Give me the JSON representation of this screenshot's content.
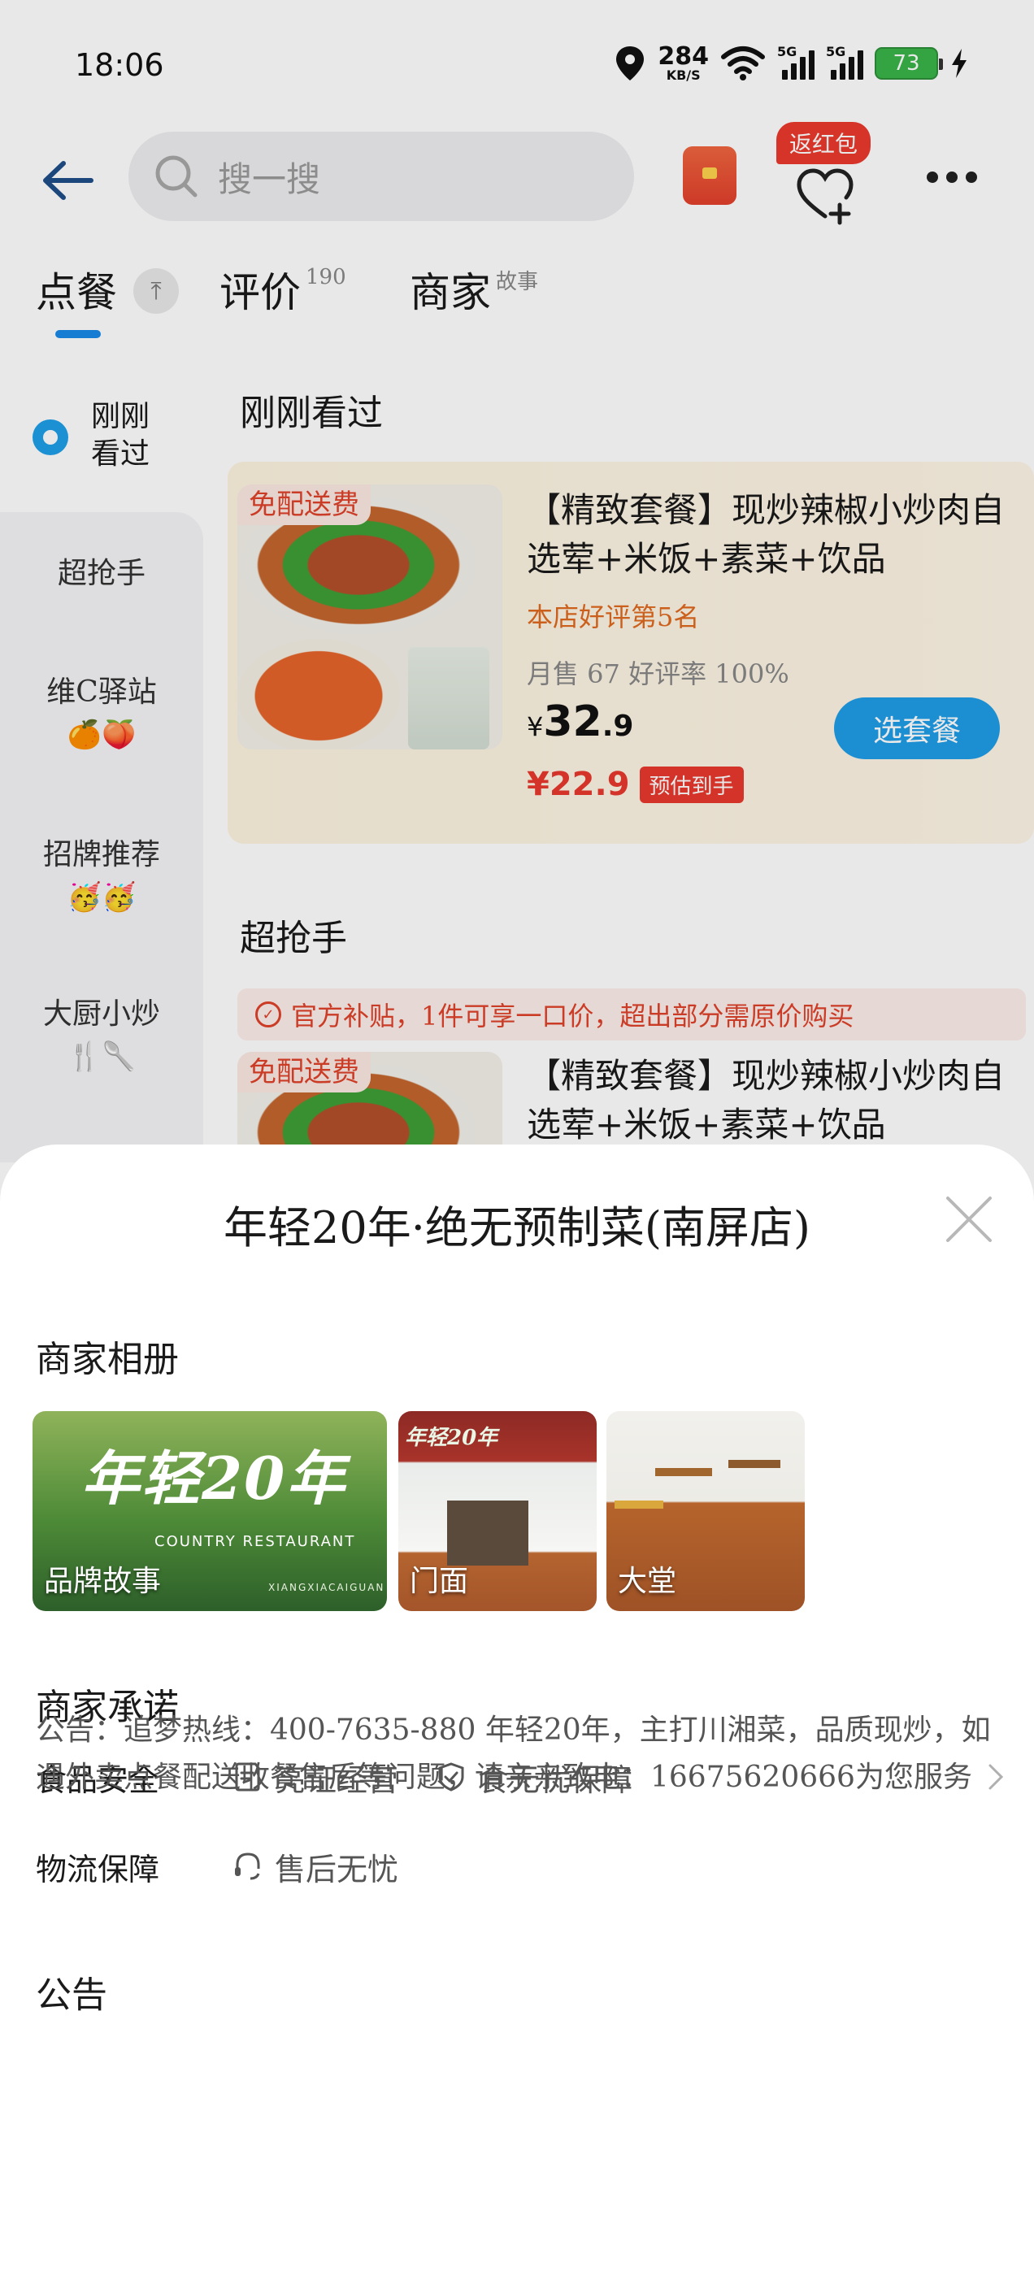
{
  "status_bar": {
    "time": "18:06",
    "net_speed": "284",
    "net_unit": "KB/S",
    "signal1_label": "5G",
    "signal2_label": "5G",
    "battery": "73"
  },
  "header": {
    "search_placeholder": "搜一搜",
    "fav_badge": "返红包"
  },
  "tabs": [
    {
      "label": "点餐",
      "sup": ""
    },
    {
      "label": "评价",
      "sup": "190"
    },
    {
      "label": "商家",
      "sup": "故事"
    }
  ],
  "sidebar": {
    "recent": "刚刚看过",
    "items": [
      {
        "label": "超抢手",
        "emoji": ""
      },
      {
        "label": "维C驿站",
        "emoji": "🍊🍑"
      },
      {
        "label": "招牌推荐",
        "emoji": "🥳🥳"
      },
      {
        "label": "大厨小炒",
        "emoji": "🍴🥄"
      }
    ]
  },
  "main": {
    "recent_title": "刚刚看过",
    "hot_title": "超抢手",
    "subsidy_text": "官方补贴，1件可享一口价，超出部分需原价购买",
    "cards": [
      {
        "free_tag": "免配送费",
        "title": "【精致套餐】现炒辣椒小炒肉自选荤+米饭+素菜+饮品",
        "rank": "本店好评第5名",
        "sales": "月售 67 好评率 100%",
        "price_currency": "¥",
        "price_int": "32",
        "price_dec": ".9",
        "est_price": "¥22.9",
        "est_tag": "预估到手",
        "button": "选套餐"
      },
      {
        "free_tag": "免配送费",
        "title": "【精致套餐】现炒辣椒小炒肉自选荤+米饭+素菜+饮品"
      }
    ]
  },
  "sheet": {
    "title": "年轻20年·绝无预制菜(南屏店)",
    "album_title": "商家相册",
    "albums": [
      {
        "caption": "品牌故事",
        "logo": "年轻20年",
        "sub": "COUNTRY RESTAURANT",
        "sub2": "XIANGXIACAIGUAN"
      },
      {
        "caption": "门面",
        "sign": "年轻20年"
      },
      {
        "caption": "大堂"
      }
    ],
    "promise_title": "商家承诺",
    "promises": [
      {
        "label": "食品安全",
        "items": [
          "亮证经营",
          "食无忧保障"
        ]
      },
      {
        "label": "物流保障",
        "items": [
          "售后无忧"
        ]
      }
    ],
    "notice_title": "公告",
    "notice_text": "公告：追梦热线：400-7635-880 年轻20年，主打川湘菜，品质现炒，如遇外卖点餐配送收餐售后等问题，请亲亲致电：16675620666为您服务"
  },
  "colors": {
    "accent_blue": "#1f9ee8",
    "price_red": "#e8392c",
    "rank_orange": "#e06a1f",
    "card_bg": "#fdf3e0"
  },
  "icons": [
    "back-arrow-icon",
    "search-icon",
    "red-packet-icon",
    "heart-plus-icon",
    "more-icon",
    "pin-top-icon",
    "eye-icon",
    "check-circle-icon",
    "close-icon",
    "license-icon",
    "shield-check-icon",
    "headset-icon",
    "chevron-right-icon"
  ]
}
